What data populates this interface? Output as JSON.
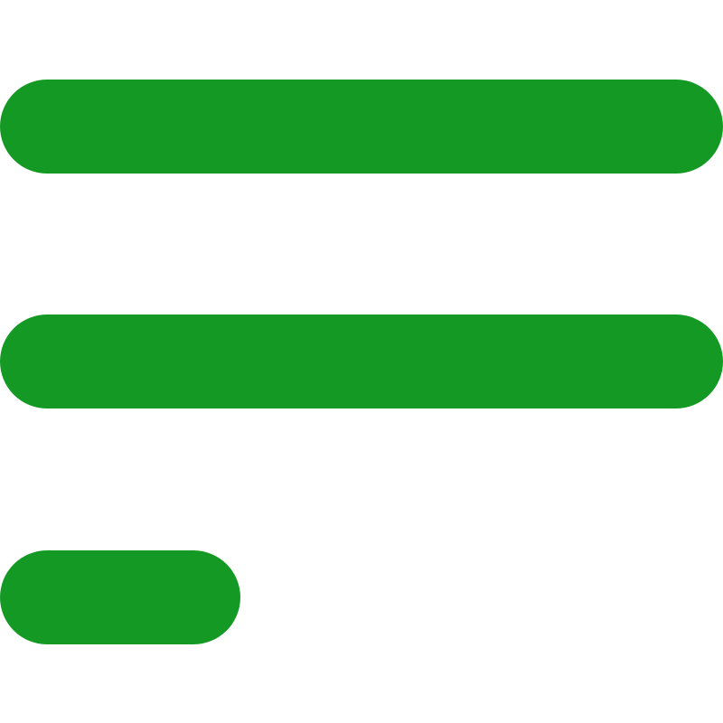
{
  "icon": {
    "name": "menu-left-icon",
    "color": "#149a24"
  },
  "background": "#ffffff"
}
